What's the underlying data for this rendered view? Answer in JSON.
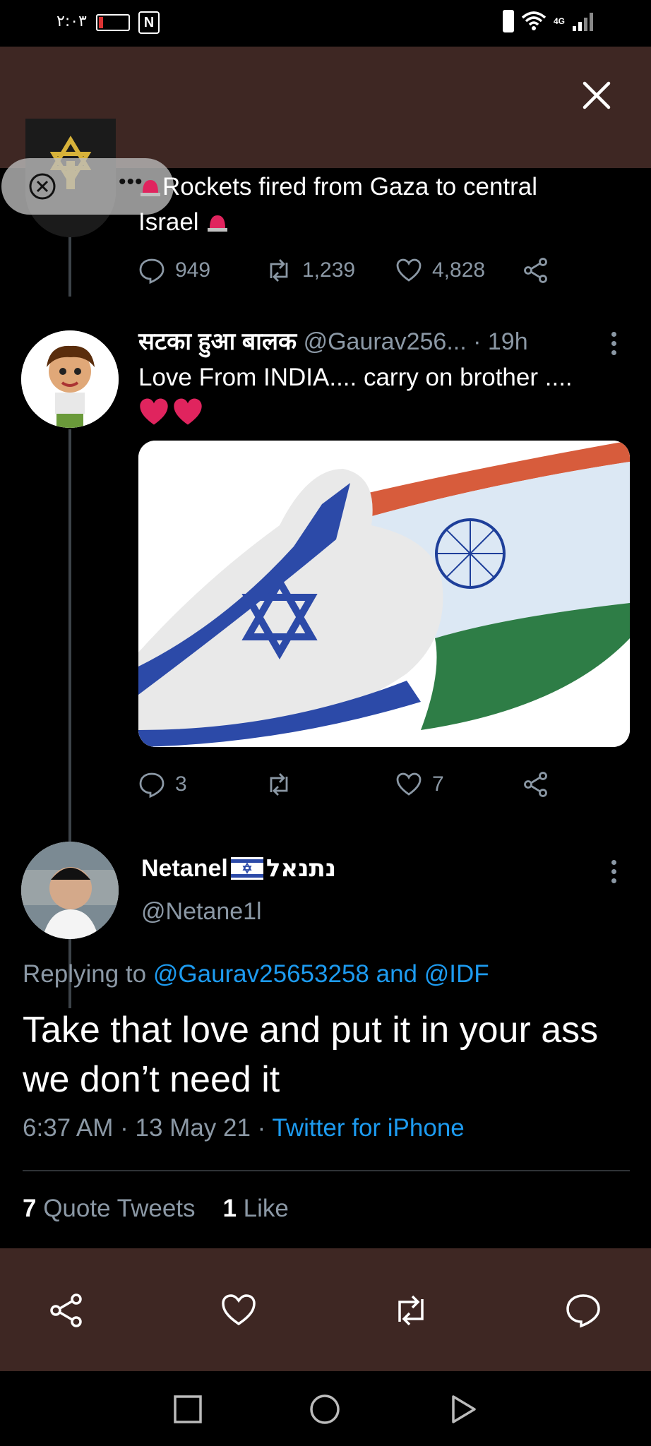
{
  "status_bar": {
    "time": "٢:٠٣",
    "network": "4G",
    "icons": [
      "battery-icon",
      "nfc-icon",
      "battery-vertical-icon",
      "wifi-icon",
      "signal-icon"
    ]
  },
  "header": {
    "more_icon": "more-horizontal-icon",
    "close_icon": "close-icon"
  },
  "overlay_pill": {
    "close_icon": "close-circle-icon",
    "more_icon": "more-horizontal-icon"
  },
  "tweet1": {
    "text_main": "Rockets fired from Gaza to central",
    "text_line2": "Israel",
    "replies": "949",
    "retweets": "1,239",
    "likes": "4,828"
  },
  "tweet2": {
    "display_name": "सटका हुआ बालक",
    "handle": "@Gaurav256...",
    "time": "· 19h",
    "text": "Love From INDIA....  carry on brother ....",
    "replies": "3",
    "likes": "7",
    "media_alt": "israel-india-handshake-image"
  },
  "tweet3": {
    "display_name_left": "Netanel",
    "display_name_right": "נתנאל",
    "handle": "@Netane1l",
    "replying_prefix": "Replying to",
    "reply_user1": "@Gaurav25653258",
    "reply_and": "and",
    "reply_user2": "@IDF",
    "text": "Take that love and put it in your ass we don’t need it",
    "timestamp": "6:37 AM · 13 May 21 ·",
    "source": "Twitter for iPhone",
    "quote_count": "7",
    "quote_label": "Quote Tweets",
    "like_count": "1",
    "like_label": "Like"
  },
  "bottom_actions": [
    "share-icon",
    "like-icon",
    "retweet-icon",
    "reply-icon"
  ],
  "nav_buttons": [
    "recents-square-icon",
    "home-circle-icon",
    "back-triangle-icon"
  ],
  "colors": {
    "brand_brown": "#3e2723",
    "link_blue": "#1d9bf0",
    "muted": "#8b98a5",
    "heart_red": "#e0245e"
  }
}
